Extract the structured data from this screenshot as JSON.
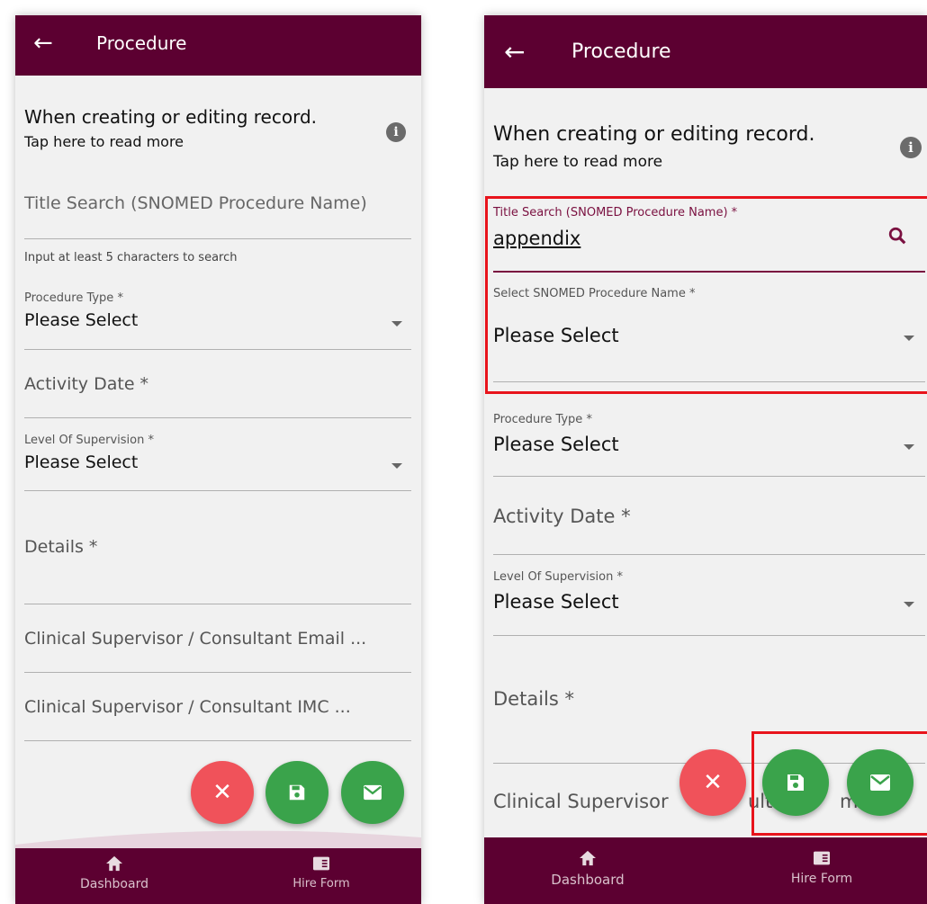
{
  "appbar": {
    "title": "Procedure"
  },
  "info": {
    "heading": "When creating or editing record.",
    "subtext": "Tap here to read more"
  },
  "fields": {
    "title_search_placeholder": "Title Search (SNOMED Procedure Name)",
    "title_search_label": "Title Search (SNOMED Procedure Name) *",
    "title_search_value": "appendix",
    "title_search_helper": "Input at least 5 characters to search",
    "snomed_select_label": "Select SNOMED Procedure Name *",
    "procedure_type_label": "Procedure Type *",
    "activity_date_label": "Activity Date *",
    "supervision_label": "Level Of Supervision *",
    "details_label": "Details *",
    "supervisor_email_label": "Clinical Supervisor / Consultant Email ...",
    "supervisor_imc_label": "Clinical Supervisor / Consultant IMC ...",
    "supervisor_partial_left": "Clinical Supervisor",
    "supervisor_partial_mid": "ult",
    "supervisor_partial_right": "ma",
    "please_select": "Please Select"
  },
  "bottom_nav": {
    "dashboard": "Dashboard",
    "hire_form": "Hire Form"
  },
  "icons": {
    "back": "arrow-left-icon",
    "info": "info-icon",
    "search": "search-icon",
    "cancel": "close-icon",
    "save": "save-icon",
    "email": "mail-icon",
    "dashboard": "home-icon",
    "hire_form": "form-icon"
  },
  "colors": {
    "appbar": "#5c0031",
    "cancel_fab": "#f0525a",
    "action_fab": "#3aa34b",
    "highlight": "#e8141c",
    "focused_label": "#7a1040"
  }
}
